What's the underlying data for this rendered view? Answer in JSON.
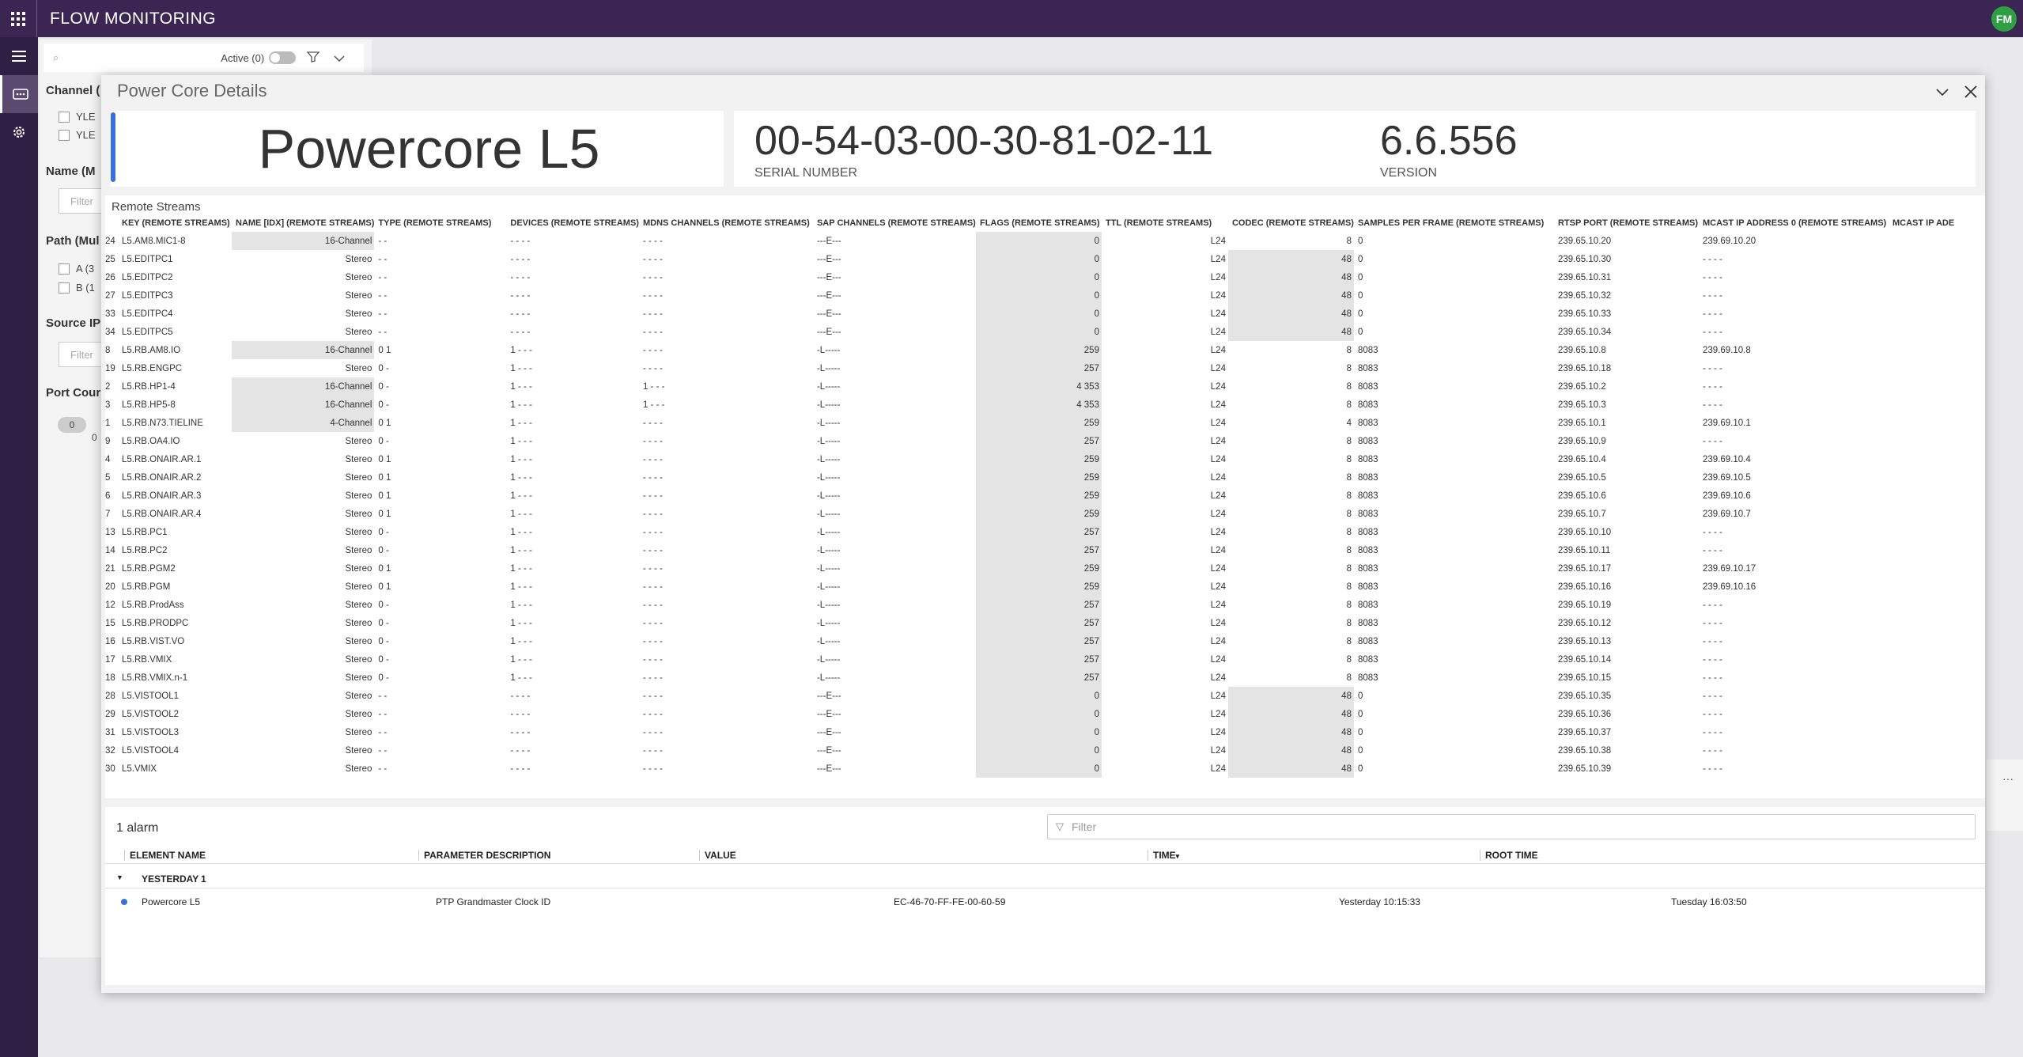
{
  "app": {
    "title": "FLOW MONITORING",
    "user_initials": "FM"
  },
  "background": {
    "active_label": "Active (0)",
    "channel_label": "Channel (",
    "channel_options": [
      "YLE",
      "YLE"
    ],
    "name_label": "Name (M",
    "filter_placeholder": "Filter",
    "path_label": "Path (Mul",
    "path_options": [
      "A (3",
      "B (1"
    ],
    "source_ip_label": "Source IP",
    "port_count_label": "Port Cour",
    "port_count_value": "0",
    "port_count_sub": "0"
  },
  "modal": {
    "title": "Power Core Details",
    "device_name": "Powercore L5",
    "serial_value": "00-54-03-00-30-81-02-11",
    "serial_label": "SERIAL NUMBER",
    "version_value": "6.6.556",
    "version_label": "VERSION"
  },
  "streams": {
    "caption": "Remote Streams",
    "columns": [
      "KEY (REMOTE STREAMS)",
      "NAME [IDX] (REMOTE STREAMS)",
      "TYPE (REMOTE STREAMS)",
      "DEVICES (REMOTE STREAMS)",
      "MDNS CHANNELS (REMOTE STREAMS)",
      "SAP CHANNELS (REMOTE STREAMS)",
      "FLAGS (REMOTE STREAMS)",
      "TTL (REMOTE STREAMS)",
      "CODEC (REMOTE STREAMS)",
      "SAMPLES PER FRAME (REMOTE STREAMS)",
      "RTSP PORT (REMOTE STREAMS)",
      "MCAST IP ADDRESS 0 (REMOTE STREAMS)",
      "MCAST IP ADE"
    ],
    "rows": [
      [
        "24",
        "L5.AM8.MIC1-8",
        "16-Channel",
        "- -",
        "- - - -",
        "- - - -",
        "---E---",
        "0",
        "L24",
        "8",
        "0",
        "239.65.10.20",
        "239.69.10.20"
      ],
      [
        "25",
        "L5.EDITPC1",
        "Stereo",
        "- -",
        "- - - -",
        "- - - -",
        "---E---",
        "0",
        "L24",
        "48",
        "0",
        "239.65.10.30",
        "- - - -"
      ],
      [
        "26",
        "L5.EDITPC2",
        "Stereo",
        "- -",
        "- - - -",
        "- - - -",
        "---E---",
        "0",
        "L24",
        "48",
        "0",
        "239.65.10.31",
        "- - - -"
      ],
      [
        "27",
        "L5.EDITPC3",
        "Stereo",
        "- -",
        "- - - -",
        "- - - -",
        "---E---",
        "0",
        "L24",
        "48",
        "0",
        "239.65.10.32",
        "- - - -"
      ],
      [
        "33",
        "L5.EDITPC4",
        "Stereo",
        "- -",
        "- - - -",
        "- - - -",
        "---E---",
        "0",
        "L24",
        "48",
        "0",
        "239.65.10.33",
        "- - - -"
      ],
      [
        "34",
        "L5.EDITPC5",
        "Stereo",
        "- -",
        "- - - -",
        "- - - -",
        "---E---",
        "0",
        "L24",
        "48",
        "0",
        "239.65.10.34",
        "- - - -"
      ],
      [
        "8",
        "L5.RB.AM8.IO",
        "16-Channel",
        "0 1",
        "1 - - -",
        "- - - -",
        "-L-----",
        "259",
        "L24",
        "8",
        "8083",
        "239.65.10.8",
        "239.69.10.8"
      ],
      [
        "19",
        "L5.RB.ENGPC",
        "Stereo",
        "0 -",
        "1 - - -",
        "- - - -",
        "-L-----",
        "257",
        "L24",
        "8",
        "8083",
        "239.65.10.18",
        "- - - -"
      ],
      [
        "2",
        "L5.RB.HP1-4",
        "16-Channel",
        "0 -",
        "1 - - -",
        "1 - - -",
        "-L-----",
        "4 353",
        "L24",
        "8",
        "8083",
        "239.65.10.2",
        "- - - -"
      ],
      [
        "3",
        "L5.RB.HP5-8",
        "16-Channel",
        "0 -",
        "1 - - -",
        "1 - - -",
        "-L-----",
        "4 353",
        "L24",
        "8",
        "8083",
        "239.65.10.3",
        "- - - -"
      ],
      [
        "1",
        "L5.RB.N73.TIELINE",
        "4-Channel",
        "0 1",
        "1 - - -",
        "- - - -",
        "-L-----",
        "259",
        "L24",
        "4",
        "8083",
        "239.65.10.1",
        "239.69.10.1"
      ],
      [
        "9",
        "L5.RB.OA4.IO",
        "Stereo",
        "0 -",
        "1 - - -",
        "- - - -",
        "-L-----",
        "257",
        "L24",
        "8",
        "8083",
        "239.65.10.9",
        "- - - -"
      ],
      [
        "4",
        "L5.RB.ONAIR.AR.1",
        "Stereo",
        "0 1",
        "1 - - -",
        "- - - -",
        "-L-----",
        "259",
        "L24",
        "8",
        "8083",
        "239.65.10.4",
        "239.69.10.4"
      ],
      [
        "5",
        "L5.RB.ONAIR.AR.2",
        "Stereo",
        "0 1",
        "1 - - -",
        "- - - -",
        "-L-----",
        "259",
        "L24",
        "8",
        "8083",
        "239.65.10.5",
        "239.69.10.5"
      ],
      [
        "6",
        "L5.RB.ONAIR.AR.3",
        "Stereo",
        "0 1",
        "1 - - -",
        "- - - -",
        "-L-----",
        "259",
        "L24",
        "8",
        "8083",
        "239.65.10.6",
        "239.69.10.6"
      ],
      [
        "7",
        "L5.RB.ONAIR.AR.4",
        "Stereo",
        "0 1",
        "1 - - -",
        "- - - -",
        "-L-----",
        "259",
        "L24",
        "8",
        "8083",
        "239.65.10.7",
        "239.69.10.7"
      ],
      [
        "13",
        "L5.RB.PC1",
        "Stereo",
        "0 -",
        "1 - - -",
        "- - - -",
        "-L-----",
        "257",
        "L24",
        "8",
        "8083",
        "239.65.10.10",
        "- - - -"
      ],
      [
        "14",
        "L5.RB.PC2",
        "Stereo",
        "0 -",
        "1 - - -",
        "- - - -",
        "-L-----",
        "257",
        "L24",
        "8",
        "8083",
        "239.65.10.11",
        "- - - -"
      ],
      [
        "21",
        "L5.RB.PGM2",
        "Stereo",
        "0 1",
        "1 - - -",
        "- - - -",
        "-L-----",
        "259",
        "L24",
        "8",
        "8083",
        "239.65.10.17",
        "239.69.10.17"
      ],
      [
        "20",
        "L5.RB.PGM",
        "Stereo",
        "0 1",
        "1 - - -",
        "- - - -",
        "-L-----",
        "259",
        "L24",
        "8",
        "8083",
        "239.65.10.16",
        "239.69.10.16"
      ],
      [
        "12",
        "L5.RB.ProdAss",
        "Stereo",
        "0 -",
        "1 - - -",
        "- - - -",
        "-L-----",
        "257",
        "L24",
        "8",
        "8083",
        "239.65.10.19",
        "- - - -"
      ],
      [
        "15",
        "L5.RB.PRODPC",
        "Stereo",
        "0 -",
        "1 - - -",
        "- - - -",
        "-L-----",
        "257",
        "L24",
        "8",
        "8083",
        "239.65.10.12",
        "- - - -"
      ],
      [
        "16",
        "L5.RB.VIST.VO",
        "Stereo",
        "0 -",
        "1 - - -",
        "- - - -",
        "-L-----",
        "257",
        "L24",
        "8",
        "8083",
        "239.65.10.13",
        "- - - -"
      ],
      [
        "17",
        "L5.RB.VMIX",
        "Stereo",
        "0 -",
        "1 - - -",
        "- - - -",
        "-L-----",
        "257",
        "L24",
        "8",
        "8083",
        "239.65.10.14",
        "- - - -"
      ],
      [
        "18",
        "L5.RB.VMIX.n-1",
        "Stereo",
        "0 -",
        "1 - - -",
        "- - - -",
        "-L-----",
        "257",
        "L24",
        "8",
        "8083",
        "239.65.10.15",
        "- - - -"
      ],
      [
        "28",
        "L5.VISTOOL1",
        "Stereo",
        "- -",
        "- - - -",
        "- - - -",
        "---E---",
        "0",
        "L24",
        "48",
        "0",
        "239.65.10.35",
        "- - - -"
      ],
      [
        "29",
        "L5.VISTOOL2",
        "Stereo",
        "- -",
        "- - - -",
        "- - - -",
        "---E---",
        "0",
        "L24",
        "48",
        "0",
        "239.65.10.36",
        "- - - -"
      ],
      [
        "31",
        "L5.VISTOOL3",
        "Stereo",
        "- -",
        "- - - -",
        "- - - -",
        "---E---",
        "0",
        "L24",
        "48",
        "0",
        "239.65.10.37",
        "- - - -"
      ],
      [
        "32",
        "L5.VISTOOL4",
        "Stereo",
        "- -",
        "- - - -",
        "- - - -",
        "---E---",
        "0",
        "L24",
        "48",
        "0",
        "239.65.10.38",
        "- - - -"
      ],
      [
        "30",
        "L5.VMIX",
        "Stereo",
        "- -",
        "- - - -",
        "- - - -",
        "---E---",
        "0",
        "L24",
        "48",
        "0",
        "239.65.10.39",
        "- - - -"
      ]
    ]
  },
  "alarms": {
    "count_label": "1 alarm",
    "filter_placeholder": "Filter",
    "columns": [
      "ELEMENT NAME",
      "PARAMETER DESCRIPTION",
      "VALUE",
      "TIME",
      "ROOT TIME"
    ],
    "group_label": "YESTERDAY",
    "group_count": "1",
    "rows": [
      {
        "element": "Powercore L5",
        "parameter": "PTP Grandmaster Clock ID",
        "value": "EC-46-70-FF-FE-00-60-59",
        "time": "Yesterday 10:15:33",
        "root_time": "Tuesday 16:03:50"
      }
    ],
    "severity_color": "#3a6fd8"
  },
  "icons": [
    "apps-grid-icon",
    "hamburger-menu-icon",
    "monitoring-icon",
    "gear-icon",
    "search-icon",
    "filter-icon",
    "chevron-down-icon",
    "close-icon",
    "ellipsis-icon",
    "sort-desc-icon",
    "expand-arrow-icon"
  ],
  "colors": {
    "header": "#3b2553",
    "nav": "#2f1f44",
    "accent": "#3a6fd8",
    "avatar": "#2ea043"
  }
}
